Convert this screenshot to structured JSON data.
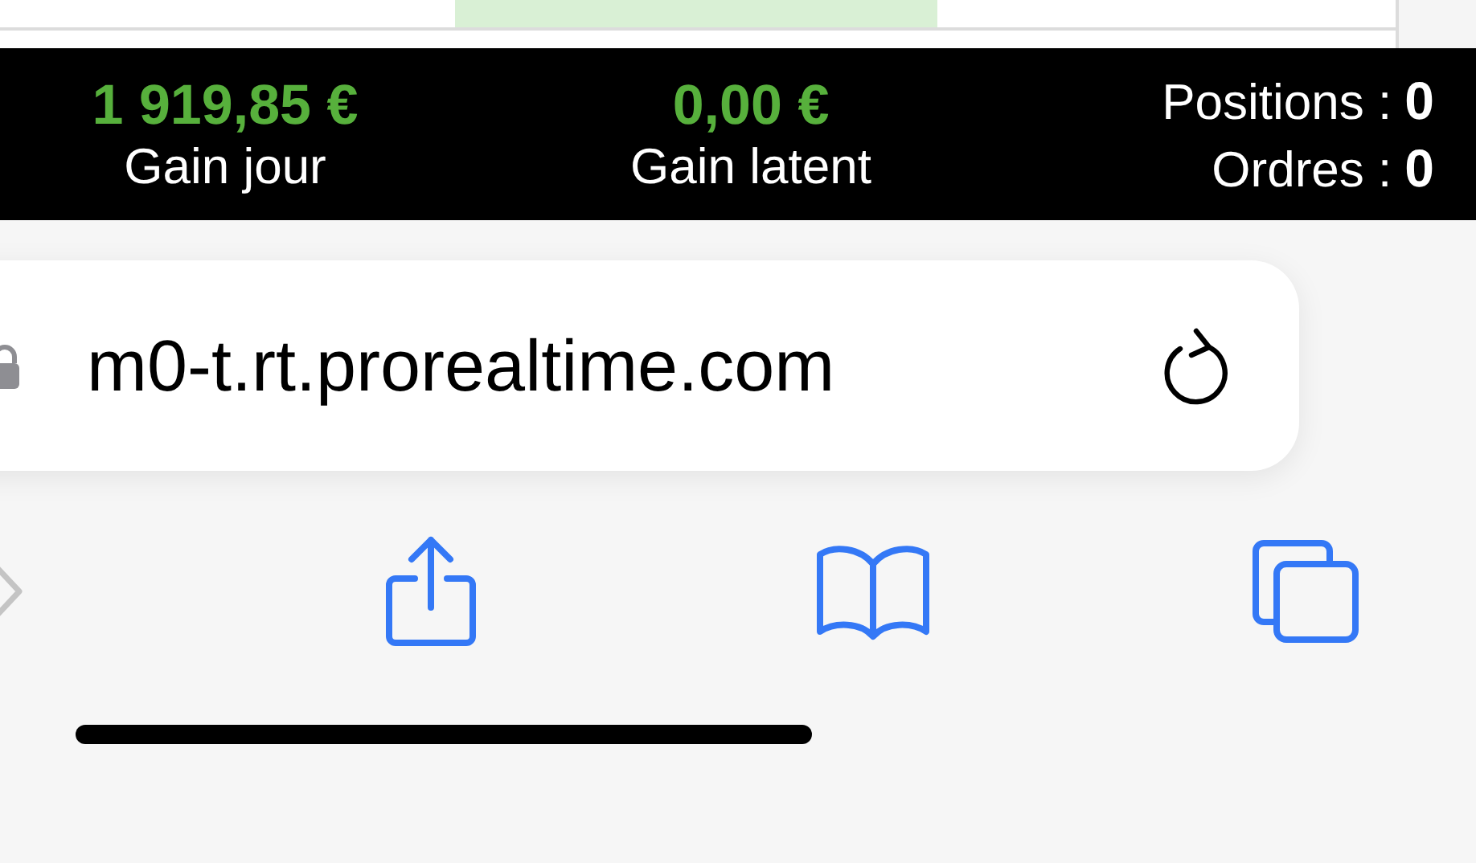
{
  "summary_bar": {
    "stats": [
      {
        "value": "1 919,85 €",
        "label": "Gain jour"
      },
      {
        "value": "0,00 €",
        "label": "Gain latent"
      }
    ],
    "counters": [
      {
        "label": "Positions :",
        "value": "0"
      },
      {
        "label": "Ordres :",
        "value": "0"
      }
    ]
  },
  "address_bar": {
    "url": "m0-t.rt.prorealtime.com"
  },
  "toolbar": [
    {
      "kind": "forward",
      "disabled": true
    },
    {
      "kind": "share",
      "disabled": false
    },
    {
      "kind": "bookmarks",
      "disabled": false
    },
    {
      "kind": "tabs",
      "disabled": false
    }
  ]
}
